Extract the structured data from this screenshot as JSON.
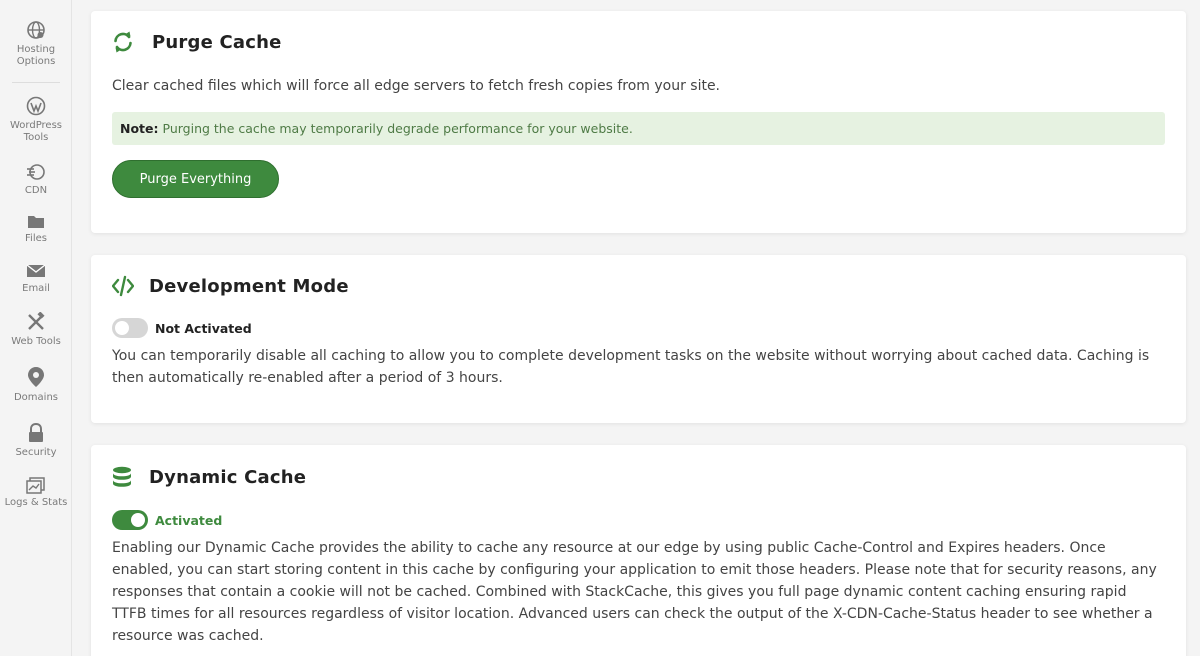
{
  "colors": {
    "accent": "#3e8a3e",
    "note_bg": "#e6f2e1",
    "note_text": "#4f7b46",
    "toggle_off": "#d6d6d6"
  },
  "sidebar": {
    "items": [
      {
        "label": "Hosting Options",
        "icon": "globe-icon"
      },
      {
        "label": "WordPress Tools",
        "icon": "wordpress-icon"
      },
      {
        "label": "CDN",
        "icon": "cdn-icon"
      },
      {
        "label": "Files",
        "icon": "folder-icon"
      },
      {
        "label": "Email",
        "icon": "envelope-icon"
      },
      {
        "label": "Web Tools",
        "icon": "tools-icon"
      },
      {
        "label": "Domains",
        "icon": "map-pin-icon"
      },
      {
        "label": "Security",
        "icon": "lock-icon"
      },
      {
        "label": "Logs & Stats",
        "icon": "logs-icon"
      }
    ]
  },
  "purge": {
    "title": "Purge Cache",
    "icon": "refresh-icon",
    "description": "Clear cached files which will force all edge servers to fetch fresh copies from your site.",
    "note_label": "Note:",
    "note_text": "Purging the cache may temporarily degrade performance for your website.",
    "button_label": "Purge Everything"
  },
  "dev_mode": {
    "title": "Development Mode",
    "icon": "code-icon",
    "toggle_state": "off",
    "toggle_label": "Not Activated",
    "description": "You can temporarily disable all caching to allow you to complete development tasks on the website without worrying about cached data. Caching is then automatically re-enabled after a period of 3 hours."
  },
  "dynamic_cache": {
    "title": "Dynamic Cache",
    "icon": "database-icon",
    "toggle_state": "on",
    "toggle_label": "Activated",
    "description": "Enabling our Dynamic Cache provides the ability to cache any resource at our edge by using public Cache-Control and Expires headers. Once enabled, you can start storing content in this cache by configuring your application to emit those headers. Please note that for security reasons, any responses that contain a cookie will not be cached. Combined with StackCache, this gives you full page dynamic content caching ensuring rapid TTFB times for all resources regardless of visitor location. Advanced users can check the output of the X-CDN-Cache-Status header to see whether a resource was cached."
  }
}
